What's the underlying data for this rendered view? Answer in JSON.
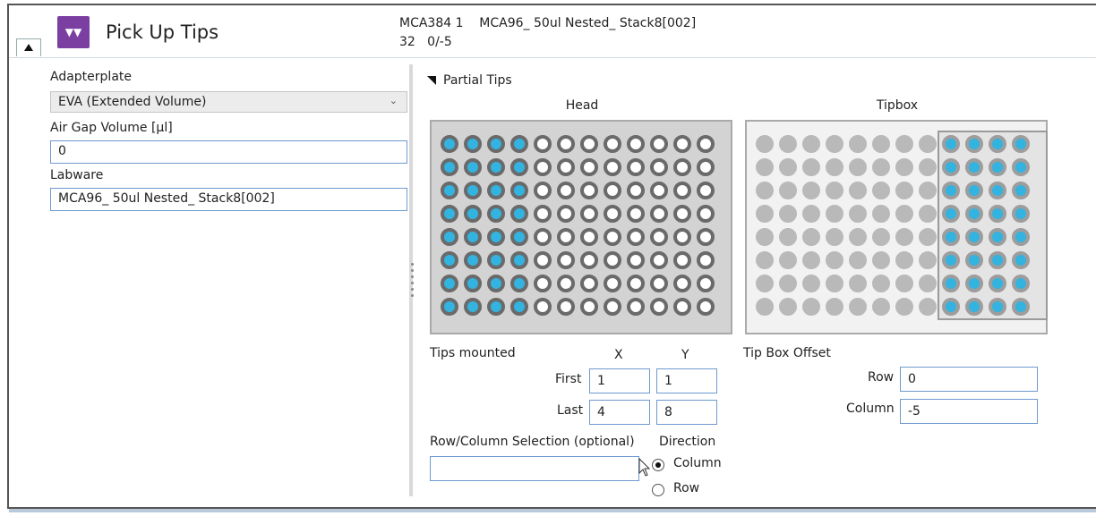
{
  "header": {
    "title": "Pick Up Tips",
    "icon": "tips-icon",
    "summary_line1": "MCA384 1    MCA96_ 50ul Nested_ Stack8[002]",
    "summary_line2": "32   0/-5"
  },
  "left_panel": {
    "adapterplate_label": "Adapterplate",
    "adapterplate_value": "EVA (Extended Volume)",
    "airgap_label": "Air Gap Volume [µl]",
    "airgap_value": "0",
    "labware_label": "Labware",
    "labware_value": "MCA96_ 50ul Nested_ Stack8[002]"
  },
  "partial_tips": {
    "section_title": "Partial Tips",
    "head_caption": "Head",
    "tipbox_caption": "Tipbox",
    "tips_mounted_label": "Tips mounted",
    "x_label": "X",
    "y_label": "Y",
    "first_label": "First",
    "last_label": "Last",
    "first_x": "1",
    "first_y": "1",
    "last_x": "4",
    "last_y": "8",
    "offset_label": "Tip Box Offset",
    "row_label": "Row",
    "row_value": "0",
    "column_label": "Column",
    "column_value": "-5",
    "selection_label": "Row/Column Selection (optional)",
    "selection_value": "",
    "direction_label": "Direction",
    "dir_column": "Column",
    "dir_row": "Row",
    "selected_direction": "Column"
  },
  "colors": {
    "accent": "#7a3fa0",
    "tip": "#33b3df",
    "input_border": "#6e9ad0"
  },
  "grid": {
    "columns": 12,
    "rows": 8,
    "head_selected_columns": [
      1,
      2,
      3,
      4
    ],
    "tipbox_selected_columns": [
      9,
      10,
      11,
      12
    ]
  }
}
